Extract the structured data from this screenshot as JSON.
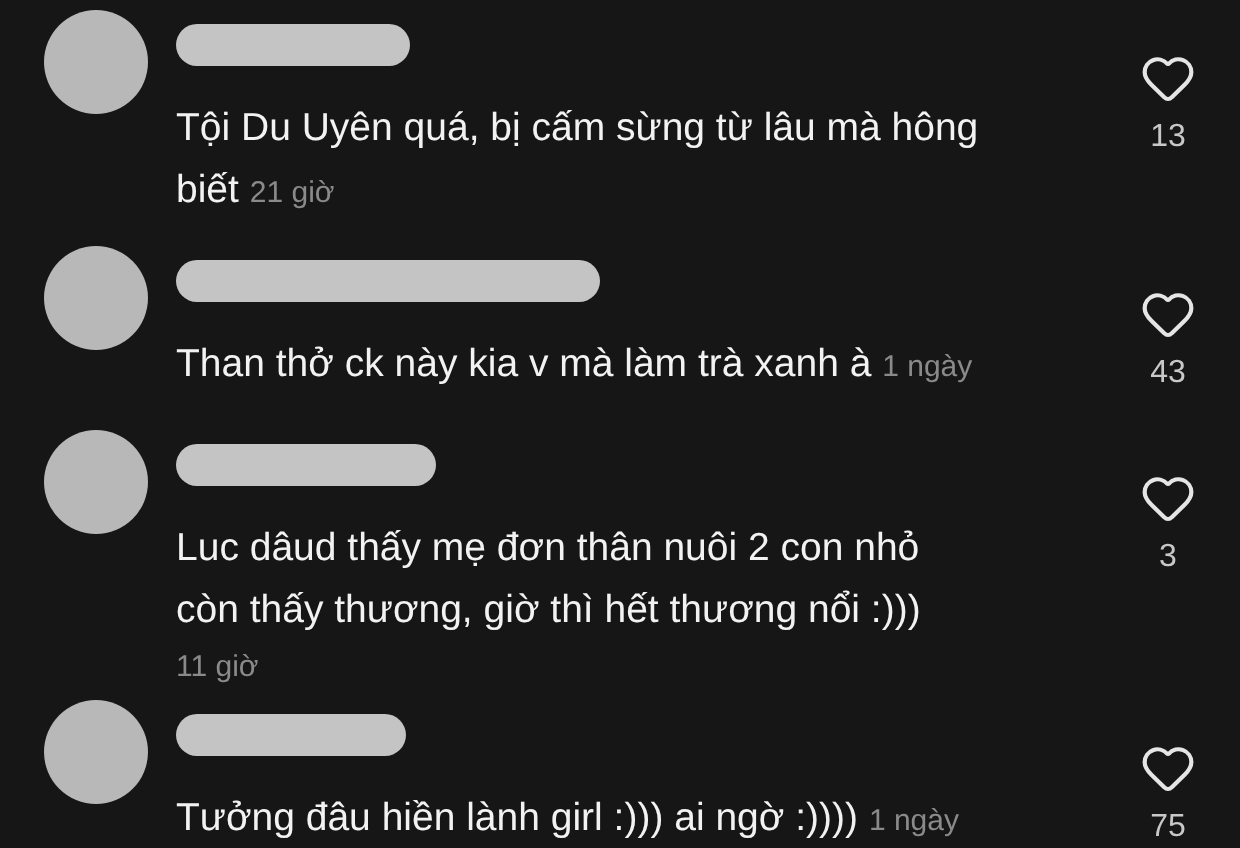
{
  "comments": [
    {
      "lines": [
        "Tội Du Uyên quá, bị cấm sừng từ lâu mà hông",
        "biết"
      ],
      "time": "21 giờ",
      "kind": "inline",
      "likes": "13"
    },
    {
      "lines": [
        "Than thở ck này kia v mà làm trà xanh à"
      ],
      "time": "1 ngày",
      "kind": "inline",
      "likes": "43"
    },
    {
      "lines": [
        "Luc dâud thấy mẹ đơn thân nuôi 2 con nhỏ",
        "còn thấy thương, giờ thì hết thương nổi :)))"
      ],
      "time": "11 giờ",
      "kind": "newline",
      "likes": "3"
    },
    {
      "lines": [
        "Tưởng đâu hiền lành girl :))) ai ngờ :))))"
      ],
      "time": "1 ngày",
      "kind": "inline",
      "likes": "75"
    }
  ]
}
